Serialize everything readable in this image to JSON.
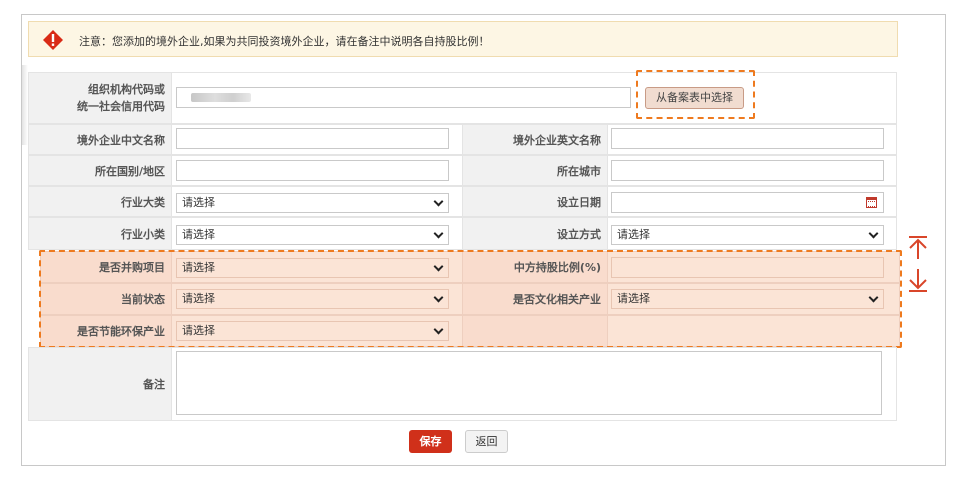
{
  "notice": {
    "icon": "warning-diamond-icon",
    "text": "注意：您添加的境外企业,如果为共同投资境外企业，请在备注中说明各自持股比例！"
  },
  "form": {
    "org_code": {
      "label_line1": "组织机构代码或",
      "label_line2": "统一社会信用代码",
      "value": ""
    },
    "pick_button": "从备案表中选择",
    "cn_name": {
      "label": "境外企业中文名称",
      "value": ""
    },
    "en_name": {
      "label": "境外企业英文名称",
      "value": ""
    },
    "country": {
      "label": "所在国别/地区",
      "value": ""
    },
    "city": {
      "label": "所在城市",
      "value": ""
    },
    "industry_major": {
      "label": "行业大类",
      "value": "请选择"
    },
    "setup_date": {
      "label": "设立日期",
      "value": ""
    },
    "industry_minor": {
      "label": "行业小类",
      "value": "请选择"
    },
    "setup_method": {
      "label": "设立方式",
      "value": "请选择"
    },
    "is_merger": {
      "label": "是否并购项目",
      "value": "请选择"
    },
    "cn_share": {
      "label": "中方持股比例(%)",
      "value": ""
    },
    "current_status": {
      "label": "当前状态",
      "value": "请选择"
    },
    "is_cultural": {
      "label": "是否文化相关产业",
      "value": "请选择"
    },
    "is_eco": {
      "label": "是否节能环保产业",
      "value": "请选择"
    },
    "remarks": {
      "label": "备注",
      "value": ""
    }
  },
  "actions": {
    "save_label": "保存",
    "back_label": "返回"
  },
  "colors": {
    "accent": "#d0301a",
    "highlight_dash": "#ee7a1f",
    "highlight_fill": "#fbe4d6"
  }
}
